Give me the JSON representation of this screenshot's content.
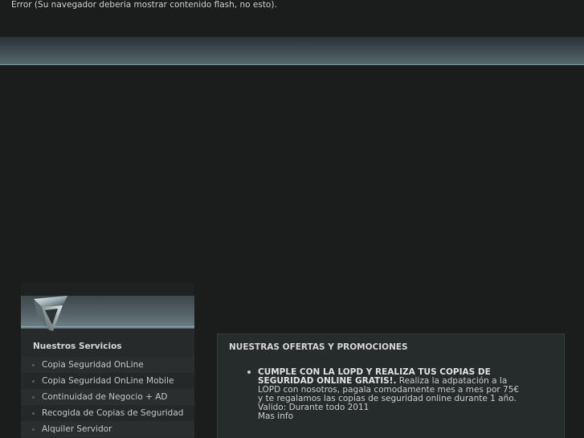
{
  "flash_error": "Error (Su navegador deberia mostrar contenido flash, no esto).",
  "sidebar": {
    "title": "Nuestros Servicios",
    "logo_icon": "chrome-shield-logo-icon",
    "items": [
      {
        "label": "Copia Seguridad OnLine"
      },
      {
        "label": "Copia Seguridad OnLine Mobile"
      },
      {
        "label": "Continuidad de Negocio + AD"
      },
      {
        "label": "Recogida de Copias de Seguridad"
      },
      {
        "label": "Alquiler Servidor"
      }
    ]
  },
  "offers": {
    "title": "NUESTRAS OFERTAS Y PROMOCIONES",
    "items": [
      {
        "headline": "CUMPLE CON LA LOPD Y REALIZA TUS COPIAS DE SEGURIDAD ONLINE GRATIS!.",
        "body": " Realiza la adpatación a la LOPD con nosotros, pagala comodamente mes a mes por 75€ y te regalamos las copias de seguridad online durante 1 año.",
        "valid": "Valido: Durante todo 2011",
        "more": "Mas info"
      }
    ]
  },
  "colors": {
    "background": "#1b1c1c",
    "band_highlight": "#7c9aa2",
    "panel": "#262b2c"
  }
}
